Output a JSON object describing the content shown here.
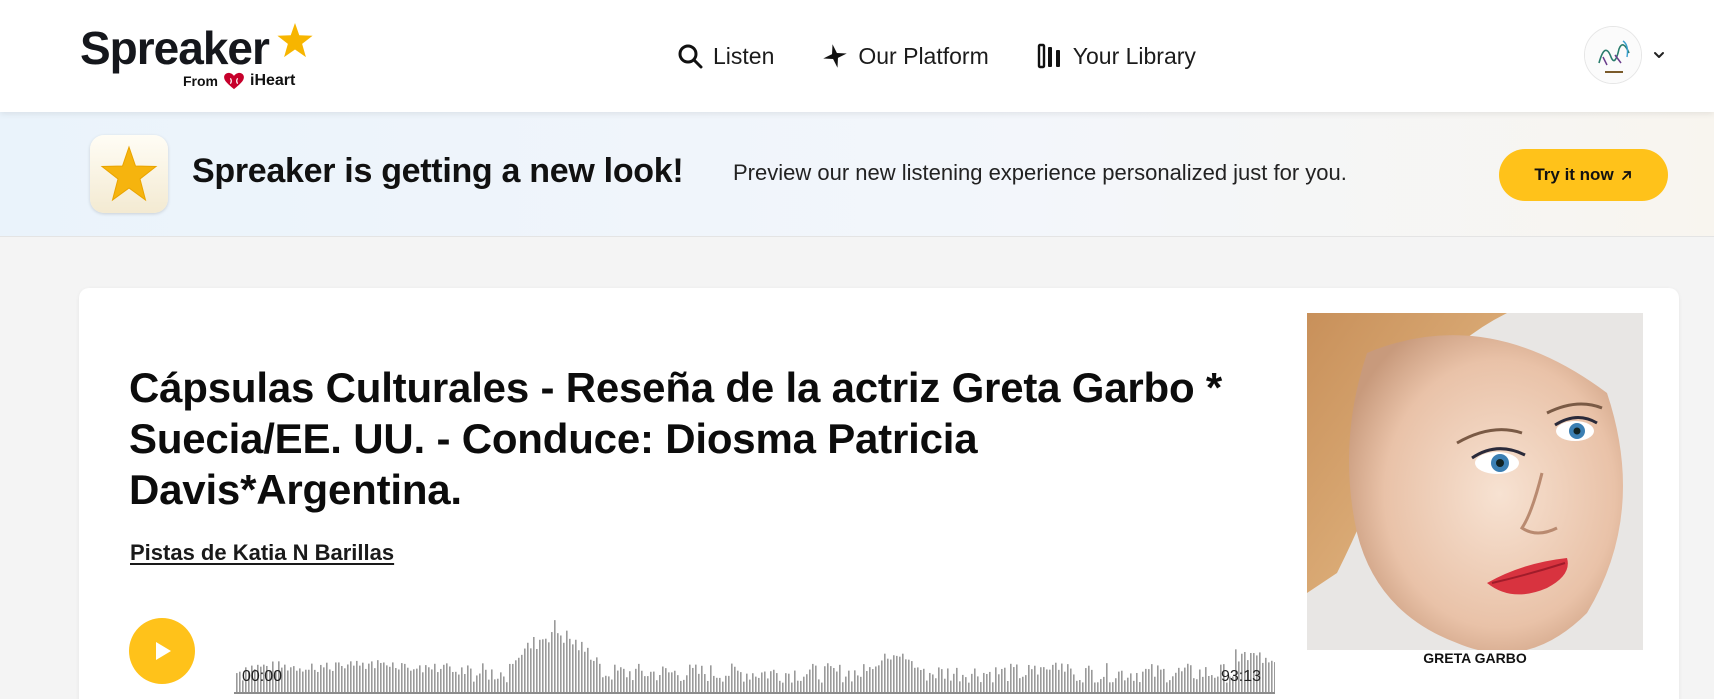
{
  "header": {
    "logo": {
      "wordmark": "Spreaker",
      "from": "From",
      "partner": "iHeart"
    },
    "nav": [
      {
        "label": "Listen",
        "icon": "search-icon"
      },
      {
        "label": "Our Platform",
        "icon": "sparkle-icon"
      },
      {
        "label": "Your Library",
        "icon": "library-icon"
      }
    ],
    "account": {
      "avatar": "user-avatar",
      "menu_icon": "chevron-down-icon"
    }
  },
  "banner": {
    "title": "Spreaker is getting a new look!",
    "subtitle": "Preview our new listening experience personalized just for you.",
    "cta": "Try it now",
    "icon": "star-icon"
  },
  "episode": {
    "title": "Cápsulas Culturales - Reseña de la actriz Greta Garbo * Suecia/EE. UU. - Conduce: Diosma Patricia Davis*Argentina.",
    "show": "Pistas de Katia N Barillas",
    "current_time": "00:00",
    "duration": "93:13",
    "cover_caption": "GRETA GARBO",
    "progress": 0
  },
  "colors": {
    "accent": "#ffc21a",
    "text": "#111111",
    "waveform": "#9a9a9a"
  }
}
